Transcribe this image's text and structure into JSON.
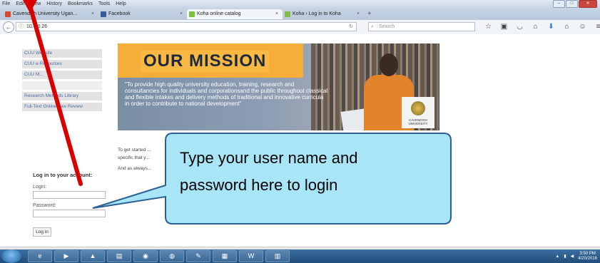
{
  "menubar": {
    "items": [
      "File",
      "Edit",
      "View",
      "History",
      "Bookmarks",
      "Tools",
      "Help"
    ]
  },
  "tabs": [
    {
      "label": "Cavendish University Ugan...",
      "color": "#d9452f"
    },
    {
      "label": "Facebook",
      "color": "#3b5998"
    },
    {
      "label": "Koha online catalog",
      "color": "#7fbf3f"
    },
    {
      "label": "Koha › Log in to Koha",
      "color": "#7fbf3f"
    }
  ],
  "nav": {
    "url": "10.0.0.26",
    "search_placeholder": "Search",
    "toolbar_icons": [
      "star-icon",
      "clipboard-icon",
      "pocket-icon",
      "home-icon",
      "download-icon",
      "house-icon",
      "chat-icon",
      "menu-icon"
    ]
  },
  "sidebar": {
    "links": [
      "CUU Website",
      "CUU e-Resources",
      "CUU M..."
    ],
    "links2": [
      "Research Methods Library",
      "Full-Text Online Law Review"
    ]
  },
  "mission": {
    "title": "OUR MISSION",
    "quote": "\"To provide high quality university education, training, research and consultancies for individuals and corporationsand the public throughout classical and flexible intakes and delivery methods of traditional and innovative curricula in order to contribute to national development\"",
    "logo_text": "CAVENDISH UNIVERSITY"
  },
  "intro": {
    "line1": "To get started ...",
    "line2": "specific that y...",
    "line3": "And as always..."
  },
  "login": {
    "heading": "Log in to your account:",
    "login_label": "Login:",
    "password_label": "Password:",
    "button": "Log in"
  },
  "callout": {
    "line1": "Type your user name and",
    "line2": "password here to login",
    "fill": "#a8e6f7",
    "stroke": "#2b5f95",
    "arrow_color": "#d90000"
  },
  "tray": {
    "time": "3:50 PM",
    "date": "4/20/2016"
  }
}
